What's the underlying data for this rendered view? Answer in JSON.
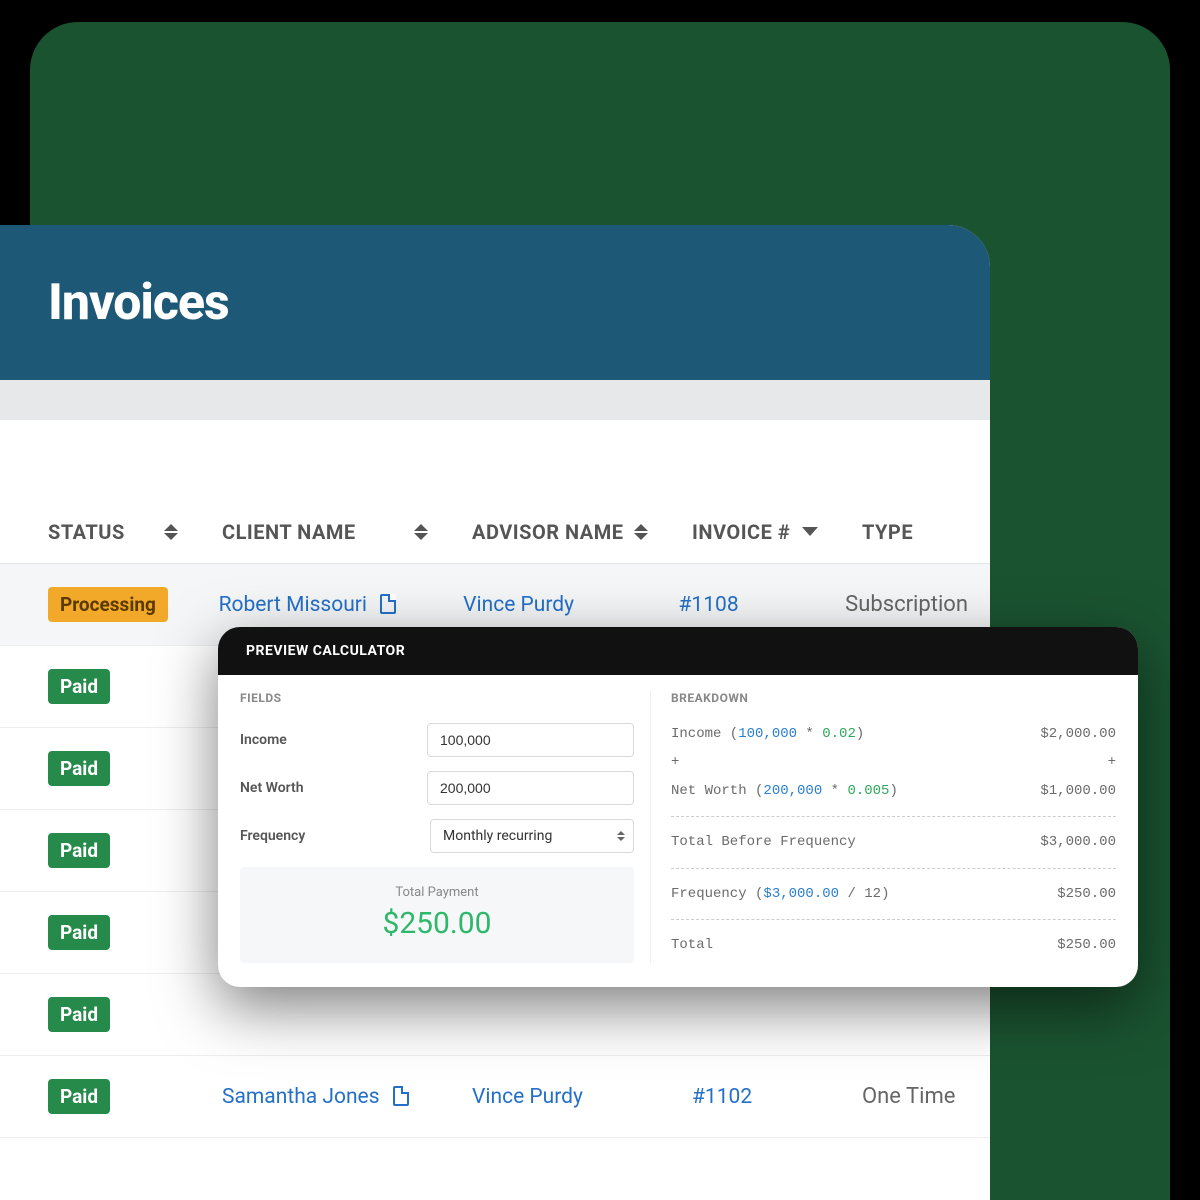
{
  "header": {
    "title": "Invoices"
  },
  "table": {
    "columns": {
      "status": "STATUS",
      "client": "CLIENT NAME",
      "advisor": "ADVISOR NAME",
      "invoice": "INVOICE #",
      "type": "TYPE"
    },
    "rows": [
      {
        "status": "Processing",
        "status_variant": "processing",
        "client": "Robert Missouri",
        "advisor": "Vince Purdy",
        "invoice": "#1108",
        "type": "Subscription"
      },
      {
        "status": "Paid",
        "status_variant": "paid",
        "client": "",
        "advisor": "",
        "invoice": "",
        "type": ""
      },
      {
        "status": "Paid",
        "status_variant": "paid",
        "client": "",
        "advisor": "",
        "invoice": "",
        "type": ""
      },
      {
        "status": "Paid",
        "status_variant": "paid",
        "client": "",
        "advisor": "",
        "invoice": "",
        "type": ""
      },
      {
        "status": "Paid",
        "status_variant": "paid",
        "client": "",
        "advisor": "",
        "invoice": "",
        "type": ""
      },
      {
        "status": "Paid",
        "status_variant": "paid",
        "client": "",
        "advisor": "",
        "invoice": "",
        "type": ""
      },
      {
        "status": "Paid",
        "status_variant": "paid",
        "client": "Samantha Jones",
        "advisor": "Vince Purdy",
        "invoice": "#1102",
        "type": "One Time"
      }
    ]
  },
  "calculator": {
    "title": "PREVIEW CALCULATOR",
    "fields_label": "FIELDS",
    "breakdown_label": "BREAKDOWN",
    "income_label": "Income",
    "income_value": "100,000",
    "networth_label": "Net Worth",
    "networth_value": "200,000",
    "frequency_label": "Frequency",
    "frequency_value": "Monthly recurring",
    "total_label": "Total Payment",
    "total_amount": "$250.00",
    "breakdown": {
      "income_prefix": "Income (",
      "income_var": "100,000",
      "income_op": " * ",
      "income_mult": "0.02",
      "income_suffix": ")",
      "income_result": "$2,000.00",
      "plus": "+",
      "networth_prefix": "Net Worth (",
      "networth_var": "200,000",
      "networth_op": " * ",
      "networth_mult": "0.005",
      "networth_suffix": ")",
      "networth_result": "$1,000.00",
      "before_freq_label": "Total Before Frequency",
      "before_freq_result": "$3,000.00",
      "freq_prefix": "Frequency (",
      "freq_var": "$3,000.00",
      "freq_div": " / 12",
      "freq_suffix": ")",
      "freq_result": "$250.00",
      "total_label": "Total",
      "total_result": "$250.00"
    }
  }
}
